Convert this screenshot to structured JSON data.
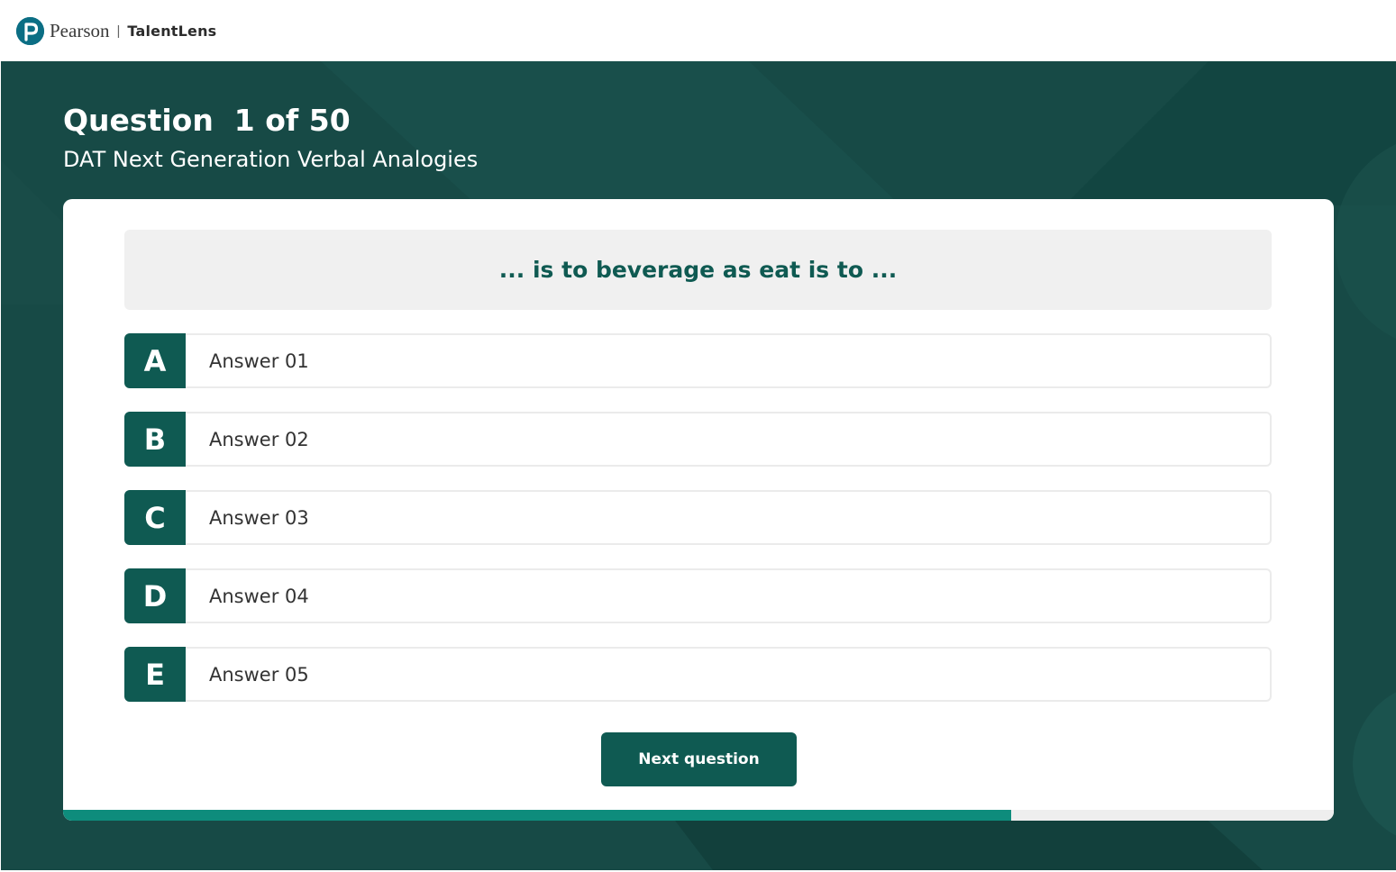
{
  "header": {
    "brand": "Pearson",
    "separator": "|",
    "product": "TalentLens"
  },
  "question": {
    "heading": "Question  1 of 50",
    "subtitle": "DAT Next Generation Verbal Analogies",
    "prompt": "... is to beverage as eat is to ..."
  },
  "answers": [
    {
      "letter": "A",
      "text": "Answer 01"
    },
    {
      "letter": "B",
      "text": "Answer 02"
    },
    {
      "letter": "C",
      "text": "Answer 03"
    },
    {
      "letter": "D",
      "text": "Answer 04"
    },
    {
      "letter": "E",
      "text": "Answer 05"
    }
  ],
  "actions": {
    "next_label": "Next question"
  },
  "progress": {
    "fraction": 0.746
  },
  "colors": {
    "background": "#174a46",
    "accent": "#0f5a52",
    "progress": "#0e8c7c",
    "logo": "#0b6e84"
  },
  "icons": {
    "logo": "pearson-p-logo-icon"
  }
}
